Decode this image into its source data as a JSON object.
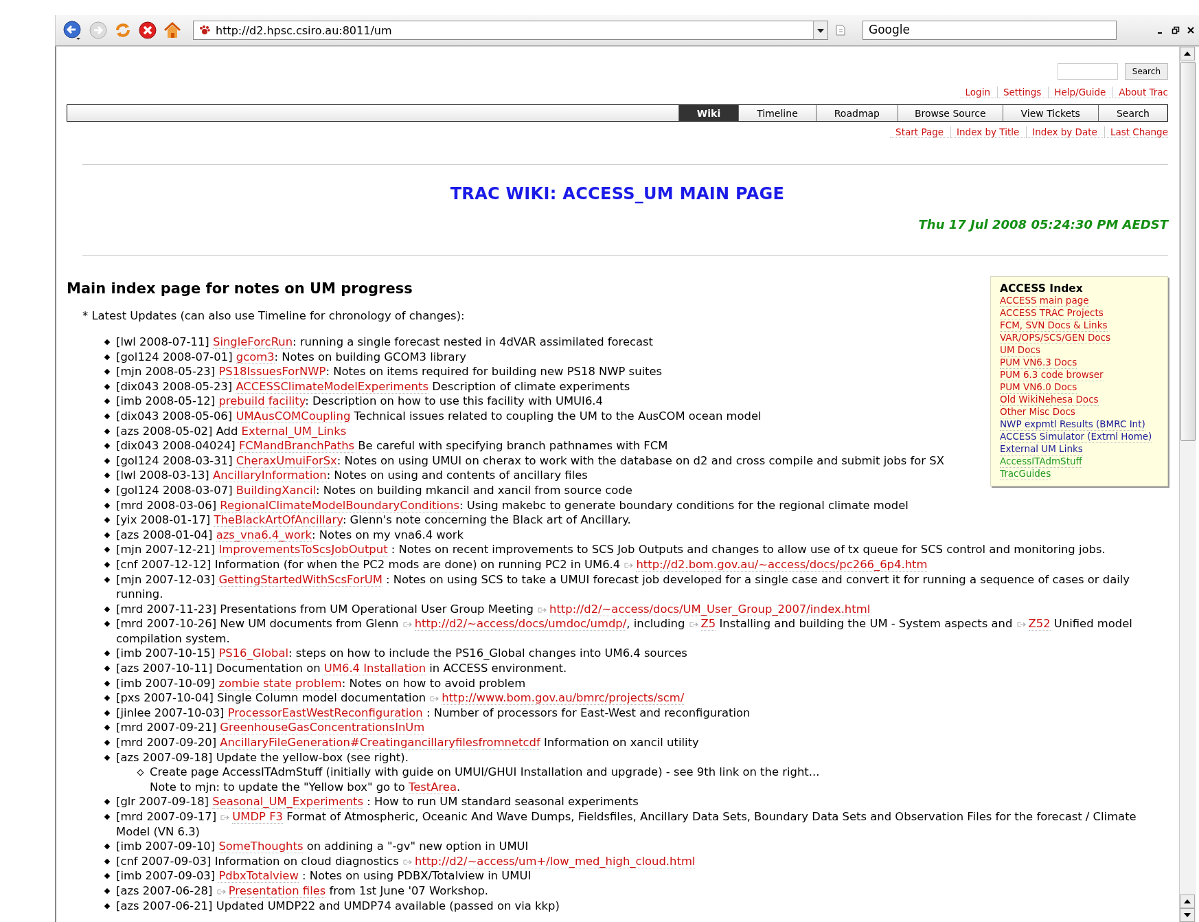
{
  "browser": {
    "url": "http://d2.hpsc.csiro.au:8011/um",
    "search_value": "Google"
  },
  "search": {
    "button": "Search"
  },
  "metanav": [
    "Login",
    "Settings",
    "Help/Guide",
    "About Trac"
  ],
  "mainnav": [
    {
      "label": "Wiki",
      "selected": true
    },
    {
      "label": "Timeline",
      "selected": false
    },
    {
      "label": "Roadmap",
      "selected": false
    },
    {
      "label": "Browse Source",
      "selected": false
    },
    {
      "label": "View Tickets",
      "selected": false
    },
    {
      "label": "Search",
      "selected": false
    }
  ],
  "ctxtnav": [
    "Start Page",
    "Index by Title",
    "Index by Date",
    "Last Change"
  ],
  "title": "TRAC WIKI: ACCESS_UM MAIN PAGE",
  "date": "Thu 17 Jul 2008 05:24:30 PM AEDST",
  "heading": "Main index page for notes on UM progress",
  "intro": "* Latest Updates (can also use Timeline for chronology of changes):",
  "access_index": {
    "title": "ACCESS Index",
    "links": [
      {
        "label": "ACCESS main page",
        "color": "#cc1111"
      },
      {
        "label": "ACCESS TRAC Projects",
        "color": "#cc1111"
      },
      {
        "label": "FCM, SVN Docs & Links",
        "color": "#cc1111"
      },
      {
        "label": "VAR/OPS/SCS/GEN Docs",
        "color": "#cc1111"
      },
      {
        "label": "UM Docs",
        "color": "#cc1111"
      },
      {
        "label": "PUM VN6.3 Docs",
        "color": "#cc1111"
      },
      {
        "label": "PUM 6.3 code browser",
        "color": "#cc1111"
      },
      {
        "label": "PUM VN6.0 Docs",
        "color": "#cc1111"
      },
      {
        "label": "Old WikiNehesa Docs",
        "color": "#cc1111"
      },
      {
        "label": "Other Misc Docs",
        "color": "#cc1111"
      },
      {
        "label": "NWP expmtl Results (BMRC Int)",
        "color": "#1a1a99"
      },
      {
        "label": "ACCESS Simulator (Extrnl Home)",
        "color": "#1a1a99"
      },
      {
        "label": "External UM Links",
        "color": "#1a1a99"
      },
      {
        "label": "AccessITAdmStuff",
        "color": "#229922"
      },
      {
        "label": "TracGuides",
        "color": "#229922"
      }
    ]
  },
  "updates": [
    {
      "parts": [
        {
          "text": "[lwl 2008-07-11] "
        },
        {
          "kind": "wiki",
          "text": "SingleForcRun"
        },
        {
          "text": ": running a single forecast nested in 4dVAR assimilated forecast"
        }
      ]
    },
    {
      "parts": [
        {
          "text": "[gol124 2008-07-01] "
        },
        {
          "kind": "wiki",
          "text": "gcom3"
        },
        {
          "text": ": Notes on building GCOM3 library"
        }
      ]
    },
    {
      "parts": [
        {
          "text": "[mjn 2008-05-23] "
        },
        {
          "kind": "wiki",
          "text": "PS18IssuesForNWP"
        },
        {
          "text": ": Notes on items required for building new PS18 NWP suites"
        }
      ]
    },
    {
      "parts": [
        {
          "text": "[dix043 2008-05-23] "
        },
        {
          "kind": "wiki",
          "text": "ACCESSClimateModelExperiments"
        },
        {
          "text": " Description of climate experiments"
        }
      ]
    },
    {
      "parts": [
        {
          "text": "[imb 2008-05-12] "
        },
        {
          "kind": "wiki",
          "text": "prebuild facility"
        },
        {
          "text": ": Description on how to use this facility with UMUI6.4"
        }
      ]
    },
    {
      "parts": [
        {
          "text": "[dix043 2008-05-06] "
        },
        {
          "kind": "wiki",
          "text": "UMAusCOMCoupling"
        },
        {
          "text": " Technical issues related to coupling the UM to the AusCOM ocean model"
        }
      ]
    },
    {
      "parts": [
        {
          "text": "[azs 2008-05-02] Add "
        },
        {
          "kind": "wiki",
          "text": "External_UM_Links"
        }
      ]
    },
    {
      "parts": [
        {
          "text": "[dix043 2008-04024] "
        },
        {
          "kind": "wiki",
          "text": "FCMandBranchPaths"
        },
        {
          "text": " Be careful with specifying branch pathnames with FCM"
        }
      ]
    },
    {
      "parts": [
        {
          "text": "[gol124 2008-03-31] "
        },
        {
          "kind": "wiki",
          "text": "CheraxUmuiForSx"
        },
        {
          "text": ": Notes on using UMUI on cherax to work with the database on d2 and cross compile and submit jobs for SX"
        }
      ]
    },
    {
      "parts": [
        {
          "text": "[lwl 2008-03-13] "
        },
        {
          "kind": "wiki",
          "text": "AncillaryInformation"
        },
        {
          "text": ": Notes on using and contents of ancillary files"
        }
      ]
    },
    {
      "parts": [
        {
          "text": "[gol124 2008-03-07] "
        },
        {
          "kind": "wiki",
          "text": "BuildingXancil"
        },
        {
          "text": ": Notes on building mkancil and xancil from source code"
        }
      ]
    },
    {
      "parts": [
        {
          "text": "[mrd 2008-03-06] "
        },
        {
          "kind": "wiki",
          "text": "RegionalClimateModelBoundaryConditions"
        },
        {
          "text": ": Using makebc to generate boundary conditions for the regional climate model"
        }
      ]
    },
    {
      "parts": [
        {
          "text": "[yix 2008-01-17] "
        },
        {
          "kind": "wiki",
          "text": "TheBlackArtOfAncillary"
        },
        {
          "text": ": Glenn's note concerning the Black art of Ancillary."
        }
      ]
    },
    {
      "parts": [
        {
          "text": "[azs 2008-01-04] "
        },
        {
          "kind": "wiki",
          "text": "azs_vna6.4_work"
        },
        {
          "text": ": Notes on my vna6.4 work"
        }
      ]
    },
    {
      "parts": [
        {
          "text": "[mjn 2007-12-21] "
        },
        {
          "kind": "wiki",
          "text": "ImprovementsToScsJobOutput"
        },
        {
          "text": " : Notes on recent improvements to SCS Job Outputs and changes to allow use of tx queue for SCS control and monitoring jobs."
        }
      ]
    },
    {
      "parts": [
        {
          "text": "[cnf 2007-12-12] Information (for when the PC2 mods are done) on running PC2 in UM6.4 "
        },
        {
          "kind": "ext",
          "text": "http://d2.bom.gov.au/~access/docs/pc266_6p4.htm"
        }
      ]
    },
    {
      "parts": [
        {
          "text": "[mjn 2007-12-03] "
        },
        {
          "kind": "wiki",
          "text": "GettingStartedWithScsForUM"
        },
        {
          "text": " : Notes on using SCS to take a UMUI forecast job developed for a single case and convert it for running a sequence of cases or daily running."
        }
      ]
    },
    {
      "parts": [
        {
          "text": "[mrd 2007-11-23] Presentations from UM Operational User Group Meeting "
        },
        {
          "kind": "ext",
          "text": "http://d2/~access/docs/UM_User_Group_2007/index.html"
        }
      ]
    },
    {
      "parts": [
        {
          "text": "[mrd 2007-10-26] New UM documents from Glenn "
        },
        {
          "kind": "ext",
          "text": "http://d2/~access/docs/umdoc/umdp/"
        },
        {
          "text": ", including "
        },
        {
          "kind": "ext",
          "text": "Z5"
        },
        {
          "text": " Installing and building the UM - System aspects and "
        },
        {
          "kind": "ext",
          "text": "Z52"
        },
        {
          "text": " Unified model compilation system."
        }
      ]
    },
    {
      "parts": [
        {
          "text": "[imb 2007-10-15] "
        },
        {
          "kind": "wiki",
          "text": "PS16_Global"
        },
        {
          "text": ": steps on how to include the PS16_Global changes into UM6.4 sources"
        }
      ]
    },
    {
      "parts": [
        {
          "text": "[azs 2007-10-11] Documentation on "
        },
        {
          "kind": "wiki",
          "text": "UM6.4 Installation"
        },
        {
          "text": " in ACCESS environment."
        }
      ]
    },
    {
      "parts": [
        {
          "text": "[imb 2007-10-09] "
        },
        {
          "kind": "wiki",
          "text": "zombie state problem"
        },
        {
          "text": ": Notes on how to avoid problem"
        }
      ]
    },
    {
      "parts": [
        {
          "text": "[pxs 2007-10-04] Single Column model documentation "
        },
        {
          "kind": "ext",
          "text": "http://www.bom.gov.au/bmrc/projects/scm/"
        }
      ]
    },
    {
      "parts": [
        {
          "text": "[jinlee 2007-10-03] "
        },
        {
          "kind": "wiki",
          "text": "ProcessorEastWestReconfiguration"
        },
        {
          "text": " : Number of processors for East-West and reconfiguration"
        }
      ]
    },
    {
      "parts": [
        {
          "text": "[mrd 2007-09-21] "
        },
        {
          "kind": "wiki",
          "text": "GreenhouseGasConcentrationsInUm"
        }
      ]
    },
    {
      "parts": [
        {
          "text": "[mrd 2007-09-20] "
        },
        {
          "kind": "wiki",
          "text": "AncillaryFileGeneration#Creatingancillaryfilesfromnetcdf"
        },
        {
          "text": " Information on xancil utility"
        }
      ]
    },
    {
      "parts": [
        {
          "text": "[azs 2007-09-18] Update the yellow-box (see right)."
        }
      ],
      "children": [
        {
          "parts": [
            {
              "text": "Create page AccessITAdmStuff (initially with guide on UMUI/GHUI Installation and upgrade) - see 9th link on the right..."
            }
          ],
          "note": [
            {
              "text": "Note to mjn: to update the \"Yellow box\" go to "
            },
            {
              "kind": "wiki",
              "text": "TestArea"
            },
            {
              "text": "."
            }
          ]
        }
      ]
    },
    {
      "parts": [
        {
          "text": "[glr 2007-09-18] "
        },
        {
          "kind": "wiki",
          "text": "Seasonal_UM_Experiments"
        },
        {
          "text": " : How to run UM standard seasonal experiments"
        }
      ]
    },
    {
      "parts": [
        {
          "text": "[mrd 2007-09-17] "
        },
        {
          "kind": "ext",
          "text": "UMDP F3"
        },
        {
          "text": " Format of Atmospheric, Oceanic And Wave Dumps, Fieldsfiles, Ancillary Data Sets, Boundary Data Sets and Observation Files for the forecast / Climate Model (VN 6.3)"
        }
      ]
    },
    {
      "parts": [
        {
          "text": "[imb 2007-09-10] "
        },
        {
          "kind": "wiki",
          "text": "SomeThoughts"
        },
        {
          "text": " on addining a \"-gv\" new option in UMUI"
        }
      ]
    },
    {
      "parts": [
        {
          "text": "[cnf 2007-09-03] Information on cloud diagnostics "
        },
        {
          "kind": "ext",
          "text": "http://d2/~access/um+/low_med_high_cloud.html"
        }
      ]
    },
    {
      "parts": [
        {
          "text": "[imb 2007-09-03] "
        },
        {
          "kind": "wiki",
          "text": "PdbxTotalview"
        },
        {
          "text": " : Notes on using PDBX/Totalview in UMUI"
        }
      ]
    },
    {
      "parts": [
        {
          "text": "[azs 2007-06-28] "
        },
        {
          "kind": "ext",
          "text": "Presentation files"
        },
        {
          "text": " from 1st June '07 Workshop."
        }
      ]
    },
    {
      "parts": [
        {
          "text": "[azs 2007-06-21] Updated UMDP22 and UMDP74 available (passed on via kkp)"
        }
      ]
    }
  ]
}
